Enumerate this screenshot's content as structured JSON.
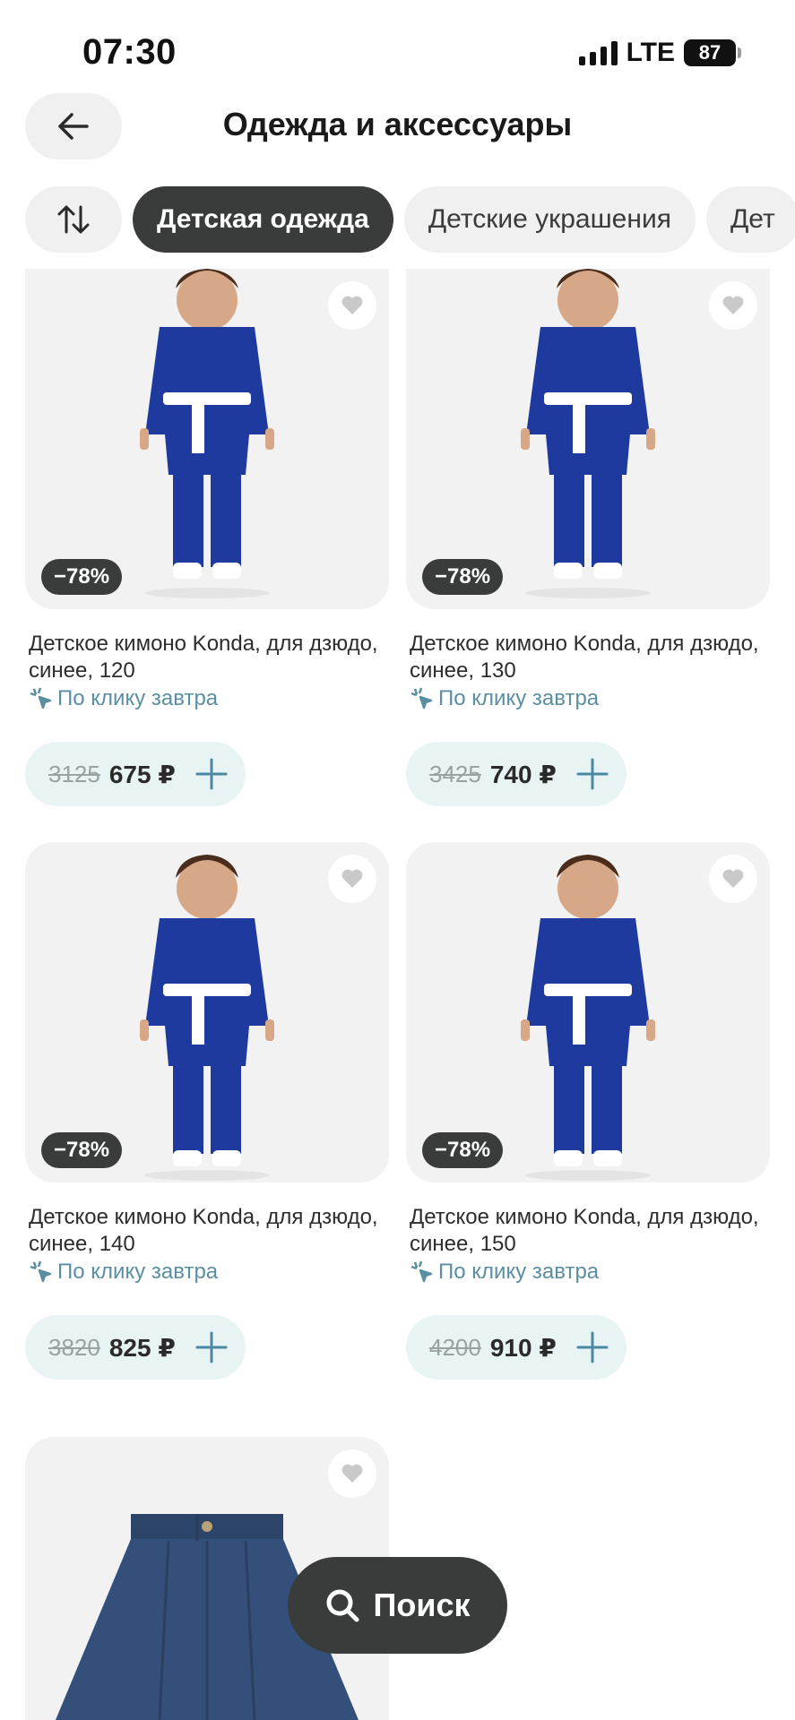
{
  "status_bar": {
    "time": "07:30",
    "network": "LTE",
    "battery": "87"
  },
  "header": {
    "back_icon": "arrow-left-icon",
    "title": "Одежда и аксессуары"
  },
  "chips": {
    "sort_icon": "sort-arrows-icon",
    "items": [
      {
        "label": "Детская одежда",
        "active": true
      },
      {
        "label": "Детские украшения",
        "active": false
      },
      {
        "label": "Дет",
        "active": false
      }
    ]
  },
  "products": [
    {
      "title": "Детское кимоно Konda, для дзюдо, синее, 120",
      "delivery": "По клику завтра",
      "discount": "−78%",
      "old_price": "3125",
      "price": "675 ₽"
    },
    {
      "title": "Детское кимоно Konda, для дзюдо, синее, 130",
      "delivery": "По клику завтра",
      "discount": "−78%",
      "old_price": "3425",
      "price": "740 ₽"
    },
    {
      "title": "Детское кимоно Konda, для дзюдо, синее, 140",
      "delivery": "По клику завтра",
      "discount": "−78%",
      "old_price": "3820",
      "price": "825 ₽"
    },
    {
      "title": "Детское кимоно Konda, для дзюдо, синее, 150",
      "delivery": "По клику завтра",
      "discount": "−78%",
      "old_price": "4200",
      "price": "910 ₽"
    }
  ],
  "search": {
    "label": "Поиск",
    "icon": "search-icon"
  },
  "colors": {
    "accent_dark": "#3a3b3b",
    "price_pill_bg": "#e8f3f3",
    "delivery_text": "#5a8fa3",
    "kimono_blue": "#1f3a9e"
  }
}
